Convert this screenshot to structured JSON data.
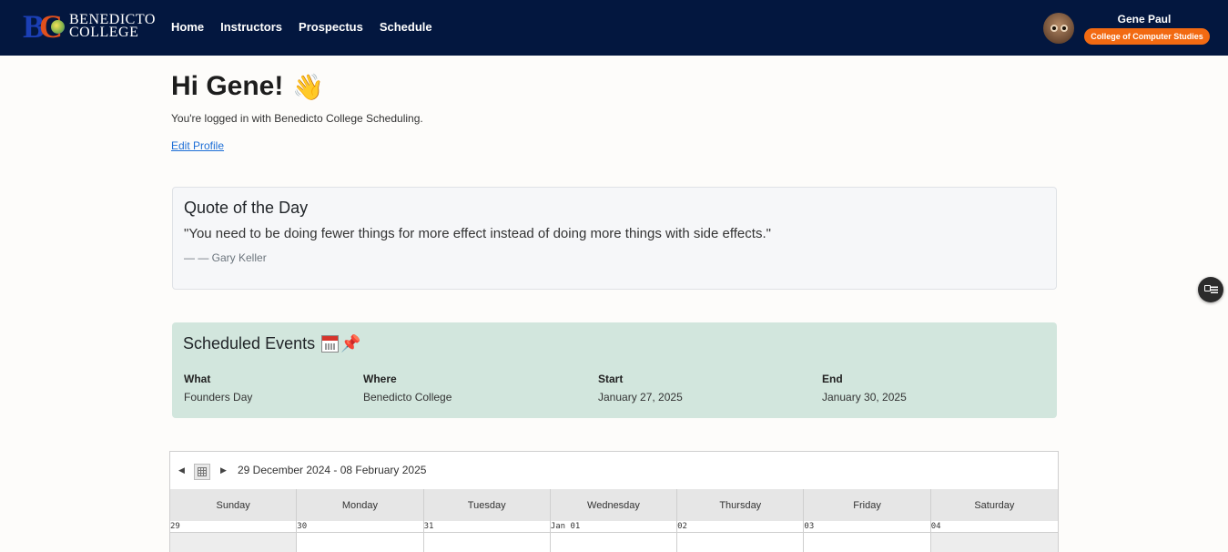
{
  "brand": {
    "line1": "BENEDICTO",
    "line2": "COLLEGE"
  },
  "nav": [
    {
      "label": "Home"
    },
    {
      "label": "Instructors"
    },
    {
      "label": "Prospectus"
    },
    {
      "label": "Schedule"
    }
  ],
  "user": {
    "name": "Gene Paul",
    "department": "College of Computer Studies"
  },
  "greeting": {
    "title": "Hi Gene!",
    "subtitle": "You're logged in with Benedicto College Scheduling.",
    "edit_link": "Edit Profile"
  },
  "quote": {
    "heading": "Quote of the Day",
    "text": "\"You need to be doing fewer things for more effect instead of doing more things with side effects.\"",
    "author": "— — Gary Keller"
  },
  "events": {
    "heading": "Scheduled Events",
    "columns": {
      "what": "What",
      "where": "Where",
      "start": "Start",
      "end": "End"
    },
    "rows": [
      {
        "what": "Founders Day",
        "where": "Benedicto College",
        "start": "January 27, 2025",
        "end": "January 30, 2025"
      }
    ]
  },
  "calendar": {
    "range": "29 December 2024 - 08 February 2025",
    "days": [
      "Sunday",
      "Monday",
      "Tuesday",
      "Wednesday",
      "Thursday",
      "Friday",
      "Saturday"
    ],
    "dates": [
      "29",
      "30",
      "31",
      "Jan 01",
      "02",
      "03",
      "04"
    ]
  },
  "icons": {
    "wave": "waving-hand-icon",
    "calendar": "calendar-icon",
    "pin": "pushpin-icon"
  },
  "colors": {
    "navbar": "#03173f",
    "accent": "#f26a12",
    "events_bg": "#d2e6dd",
    "link": "#1e6fd6"
  }
}
